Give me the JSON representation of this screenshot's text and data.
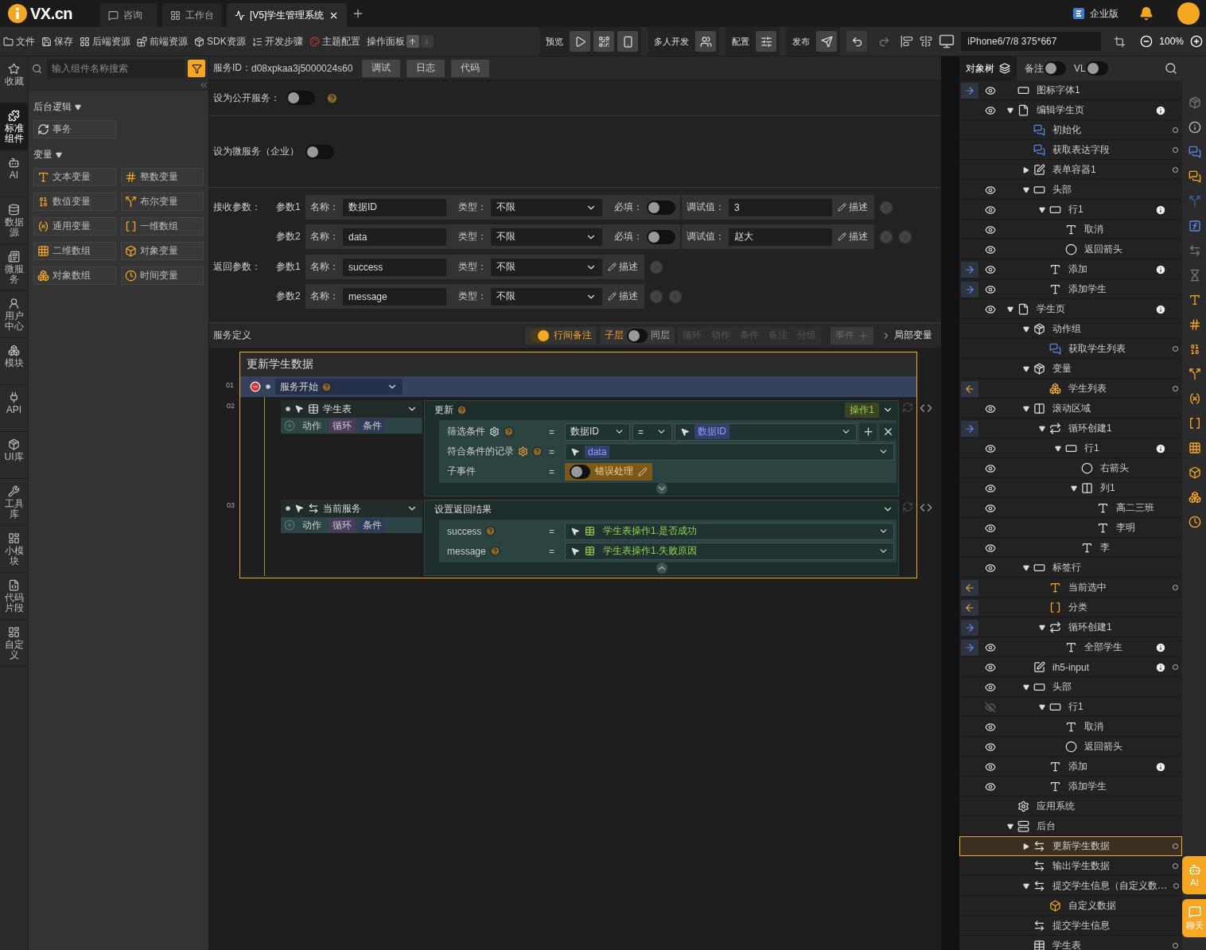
{
  "topbar": {
    "logo": "VX.cn",
    "tabs": [
      {
        "label": "咨询",
        "selected": false
      },
      {
        "label": "工作台",
        "selected": false
      },
      {
        "label": "[V5]学生管理系统",
        "selected": true
      }
    ],
    "edition": "企业版"
  },
  "toolbar": {
    "menus": [
      "文件",
      "保存",
      "后端资源",
      "前端资源",
      "SDK资源",
      "开发步骤",
      "主题配置"
    ],
    "panel": "操作面板",
    "groups": [
      {
        "label": "预览",
        "kind": "preview"
      },
      {
        "label": "多人开发",
        "kind": "team"
      },
      {
        "label": "配置",
        "kind": "config"
      },
      {
        "label": "发布",
        "kind": "publish"
      }
    ],
    "device": "iPhone6/7/8 375*667",
    "zoom": "100%"
  },
  "rail": [
    {
      "label": "收藏",
      "selected": false
    },
    {
      "label": "标准组件",
      "selected": true
    },
    {
      "label": "AI",
      "selected": false
    },
    {
      "label": "数据源",
      "selected": false
    },
    {
      "label": "微服务",
      "selected": false
    },
    {
      "label": "用户中心",
      "selected": false
    },
    {
      "label": "模块",
      "selected": false
    },
    {
      "label": "API",
      "selected": false
    },
    {
      "label": "UI库",
      "selected": false
    },
    {
      "label": "工具库",
      "selected": false
    },
    {
      "label": "小模块",
      "selected": false
    },
    {
      "label": "代码片段",
      "selected": false
    },
    {
      "label": "自定义",
      "selected": false
    }
  ],
  "library": {
    "search": {
      "placeholder": "输入组件名称搜索"
    },
    "sections": [
      {
        "title": "后台逻辑",
        "expanded": true,
        "items": [
          "事务"
        ]
      },
      {
        "title": "变量",
        "expanded": true,
        "items": [
          "文本变量",
          "整数变量",
          "数值变量",
          "布尔变量",
          "通用变量",
          "一维数组",
          "二维数组",
          "对象变量",
          "对象数组",
          "时间变量"
        ]
      }
    ]
  },
  "service": {
    "id_label": "服务ID：",
    "id": "d08xpkaa3j5000024s60",
    "buttons": [
      "调试",
      "日志",
      "代码"
    ],
    "public": {
      "label": "设为公开服务：",
      "on": false
    },
    "micro": {
      "label": "设为微服务（企业）",
      "on": false
    },
    "inputs": {
      "label": "接收参数：",
      "params": [
        {
          "index": "参数1",
          "name_label": "名称：",
          "name": "数据ID",
          "type_label": "类型：",
          "type": "不限",
          "required_label": "必填：",
          "required": false,
          "debug_label": "调试值：",
          "debug": "3",
          "describe": "描述"
        },
        {
          "index": "参数2",
          "name_label": "名称：",
          "name": "data",
          "type_label": "类型：",
          "type": "不限",
          "required_label": "必填：",
          "required": false,
          "debug_label": "调试值：",
          "debug": "赵大",
          "describe": "描述"
        }
      ]
    },
    "outputs": {
      "label": "返回参数：",
      "params": [
        {
          "index": "参数1",
          "name_label": "名称：",
          "name": "success",
          "type_label": "类型：",
          "type": "不限",
          "describe": "描述"
        },
        {
          "index": "参数2",
          "name_label": "名称：",
          "name": "message",
          "type_label": "类型：",
          "type": "不限",
          "describe": "描述"
        }
      ]
    }
  },
  "definition": {
    "title": "服务定义",
    "note": {
      "label": "行间备注",
      "on": true
    },
    "layer": {
      "left": "子层",
      "right": "同层",
      "on": false
    },
    "tools": [
      {
        "label": "循环",
        "disabled": true
      },
      {
        "label": "动作",
        "disabled": true
      },
      {
        "label": "条件",
        "disabled": true
      },
      {
        "label": "备注",
        "disabled": true
      },
      {
        "label": "分组",
        "disabled": true
      }
    ],
    "event": {
      "label": "事件",
      "disabled": true
    },
    "local_vars": "局部变量"
  },
  "flow": {
    "title": "更新学生数据",
    "start": {
      "line": "01",
      "label": "服务开始"
    },
    "steps": [
      {
        "line": "02",
        "kind": "table",
        "target": "学生表",
        "actions": [
          "动作",
          "循环",
          "条件"
        ],
        "header": "更新",
        "help": true,
        "op": "操作1",
        "expanded": true,
        "rows": [
          {
            "kind": "filter",
            "label": "筛选条件",
            "sign": "=",
            "field": "数据ID",
            "operator": "=",
            "value": "数据ID"
          },
          {
            "kind": "variable",
            "label": "符合条件的记录",
            "gear": true,
            "sign": "=",
            "value": "data"
          },
          {
            "kind": "subevent",
            "label": "子事件",
            "sign": "=",
            "toggle": {
              "label": "错误处理",
              "on": false
            }
          }
        ]
      },
      {
        "line": "03",
        "kind": "service",
        "target": "当前服务",
        "actions": [
          "动作",
          "循环",
          "条件"
        ],
        "header": "设置返回结果",
        "help": false,
        "expanded": false,
        "rows": [
          {
            "kind": "field",
            "label": "success",
            "help": true,
            "sign": "=",
            "value": "学生表操作1.是否成功"
          },
          {
            "kind": "field",
            "label": "message",
            "help": true,
            "sign": "=",
            "value": "学生表操作1.失败原因"
          }
        ]
      }
    ]
  },
  "objects": {
    "tabs": [
      {
        "label": "对象树",
        "selected": true
      }
    ],
    "toggles": [
      {
        "label": "备注",
        "on": false
      },
      {
        "label": "VL",
        "on": false
      }
    ],
    "tree": [
      {
        "label": "图标字体1",
        "kind": "btn",
        "incoming": true,
        "visible": true,
        "selected": false
      },
      {
        "label": "编辑学生页",
        "kind": "page",
        "visible": true,
        "expanded": true,
        "info": true,
        "selected": false,
        "children": [
          {
            "label": "初始化",
            "kind": "event",
            "dot": true,
            "selected": false
          },
          {
            "label": "获取表达字段",
            "kind": "event",
            "dot": true,
            "selected": false
          },
          {
            "label": "表单容器1",
            "kind": "form",
            "expanded": false,
            "dot": true,
            "selected": false
          },
          {
            "label": "头部",
            "kind": "row",
            "visible": true,
            "expanded": true,
            "selected": false,
            "children": [
              {
                "label": "行1",
                "kind": "row",
                "visible": true,
                "expanded": true,
                "info": true,
                "selected": false,
                "children": [
                  {
                    "label": "取消",
                    "kind": "text",
                    "visible": true,
                    "selected": false
                  },
                  {
                    "label": "返回箭头",
                    "kind": "kon",
                    "visible": true,
                    "selected": false
                  }
                ]
              },
              {
                "label": "添加",
                "kind": "text",
                "incoming": true,
                "visible": true,
                "info": true,
                "selected": false
              },
              {
                "label": "添加学生",
                "kind": "text",
                "incoming": true,
                "visible": true,
                "selected": false
              }
            ]
          }
        ]
      },
      {
        "label": "学生页",
        "kind": "page",
        "visible": true,
        "expanded": true,
        "info": true,
        "selected": false,
        "children": [
          {
            "label": "动作组",
            "kind": "group",
            "expanded": true,
            "selected": false,
            "children": [
              {
                "label": "获取学生列表",
                "kind": "event",
                "dot": true,
                "selected": false
              }
            ]
          },
          {
            "label": "变量",
            "kind": "group",
            "expanded": true,
            "selected": false,
            "children": [
              {
                "label": "学生列表",
                "kind": "objarray",
                "outgoing": true,
                "dot": true,
                "selected": false
              }
            ]
          },
          {
            "label": "滚动区域",
            "kind": "scroll",
            "visible": true,
            "expanded": true,
            "selected": false,
            "children": [
              {
                "label": "循环创建1",
                "kind": "loop",
                "incoming": true,
                "expanded": true,
                "selected": false,
                "children": [
                  {
                    "label": "行1",
                    "kind": "row",
                    "visible": true,
                    "expanded": true,
                    "info": true,
                    "selected": false,
                    "children": [
                      {
                        "label": "右箭头",
                        "kind": "kon",
                        "visible": true,
                        "selected": false
                      },
                      {
                        "label": "列1",
                        "kind": "scroll",
                        "visible": true,
                        "expanded": true,
                        "selected": false,
                        "children": [
                          {
                            "label": "高二三班",
                            "kind": "text",
                            "visible": true,
                            "selected": false
                          },
                          {
                            "label": "李明",
                            "kind": "text",
                            "visible": true,
                            "selected": false
                          }
                        ]
                      },
                      {
                        "label": "李",
                        "kind": "text",
                        "visible": true,
                        "selected": false
                      }
                    ]
                  }
                ]
              }
            ]
          },
          {
            "label": "标签行",
            "kind": "row",
            "visible": true,
            "expanded": true,
            "selected": false,
            "children": [
              {
                "label": "当前选中",
                "kind": "vartext",
                "outgoing": true,
                "dot": true,
                "selected": false
              },
              {
                "label": "分类",
                "kind": "array",
                "outgoing": true,
                "selected": false
              },
              {
                "label": "循环创建1",
                "kind": "loop",
                "incoming": true,
                "expanded": true,
                "selected": false,
                "children": [
                  {
                    "label": "全部学生",
                    "kind": "text",
                    "incoming": true,
                    "visible": true,
                    "info": true,
                    "selected": false
                  }
                ]
              }
            ]
          },
          {
            "label": "ih5-input",
            "kind": "input",
            "visible": true,
            "info": true,
            "dot": true,
            "selected": false
          },
          {
            "label": "头部",
            "kind": "row",
            "visible": true,
            "expanded": true,
            "selected": false,
            "children": [
              {
                "label": "行1",
                "kind": "row",
                "visible": false,
                "expanded": true,
                "selected": false,
                "children": [
                  {
                    "label": "取消",
                    "kind": "text",
                    "visible": true,
                    "selected": false
                  },
                  {
                    "label": "返回箭头",
                    "kind": "kon",
                    "visible": true,
                    "selected": false
                  }
                ]
              },
              {
                "label": "添加",
                "kind": "text",
                "visible": true,
                "info": true,
                "selected": false
              },
              {
                "label": "添加学生",
                "kind": "text",
                "visible": true,
                "selected": false
              }
            ]
          }
        ]
      },
      {
        "label": "应用系统",
        "kind": "gear",
        "selected": false
      },
      {
        "label": "后台",
        "kind": "server",
        "expanded": true,
        "selected": false,
        "children": [
          {
            "label": "更新学生数据",
            "kind": "service",
            "expanded": false,
            "dot": true,
            "selected": true
          },
          {
            "label": "输出学生数据",
            "kind": "service",
            "dot": true,
            "selected": false
          },
          {
            "label": "提交学生信息（自定义数…",
            "kind": "service",
            "expanded": true,
            "dot": true,
            "selected": false,
            "children": [
              {
                "label": "自定义数据",
                "kind": "object",
                "selected": false
              }
            ]
          },
          {
            "label": "提交学生信息",
            "kind": "service",
            "selected": false
          },
          {
            "label": "学生表",
            "kind": "table",
            "dot": true,
            "selected": false
          }
        ]
      }
    ]
  },
  "assist": [
    "AI",
    "聊天"
  ]
}
